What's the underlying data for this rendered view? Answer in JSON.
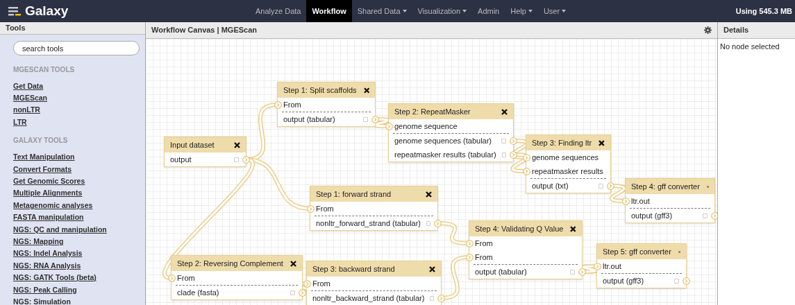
{
  "brand": "Galaxy",
  "nav": [
    {
      "label": "Analyze Data",
      "selected": false,
      "dropdown": false
    },
    {
      "label": "Workflow",
      "selected": true,
      "dropdown": false
    },
    {
      "label": "Shared Data",
      "selected": false,
      "dropdown": true
    },
    {
      "label": "Visualization",
      "selected": false,
      "dropdown": true
    },
    {
      "label": "Admin",
      "selected": false,
      "dropdown": false
    },
    {
      "label": "Help",
      "selected": false,
      "dropdown": true
    },
    {
      "label": "User",
      "selected": false,
      "dropdown": true
    }
  ],
  "usage": "Using 545.3 MB",
  "tools_panel": {
    "title": "Tools",
    "search": {
      "placeholder": "search tools"
    },
    "sections": [
      {
        "heading": "MGESCAN TOOLS",
        "items": [
          "Get Data",
          "MGEScan",
          "nonLTR",
          "LTR"
        ]
      },
      {
        "heading": "GALAXY TOOLS",
        "items": [
          "Text Manipulation",
          "Convert Formats",
          "Get Genomic Scores",
          "Multiple Alignments",
          "Metagenomic analyses",
          "FASTA manipulation",
          "NGS: QC and manipulation",
          "NGS: Mapping",
          "NGS: Indel Analysis",
          "NGS: RNA Analysis",
          "NGS: GATK Tools (beta)",
          "NGS: Peak Calling",
          "NGS: Simulation"
        ]
      }
    ]
  },
  "canvas": {
    "title": "Workflow Canvas | MGEScan",
    "nodes": [
      {
        "title": "Step 1: Split scaffolds",
        "inputs": [
          "From"
        ],
        "outputs": [
          {
            "label": "output (tabular)",
            "checked": false
          }
        ]
      },
      {
        "title": "Step 2: RepeatMasker",
        "inputs": [
          "genome sequence"
        ],
        "outputs": [
          {
            "label": "genome sequences (tabular)",
            "checked": false
          },
          {
            "label": "repeatmasker results (tabular)",
            "checked": false
          }
        ]
      },
      {
        "title": "Input dataset",
        "outputs": [
          {
            "label": "output",
            "checked": false
          }
        ]
      },
      {
        "title": "Step 3: Finding ltr",
        "inputs": [
          "genome sequences",
          "repeatmasker results"
        ],
        "outputs": [
          {
            "label": "output (txt)",
            "checked": false
          }
        ]
      },
      {
        "title": "Step 4: gff converter",
        "inputs": [
          "ltr.out"
        ],
        "outputs": [
          {
            "label": "output (gff3)",
            "checked": false
          }
        ]
      },
      {
        "title": "Step 1: forward strand",
        "inputs": [
          "From"
        ],
        "outputs": [
          {
            "label": "nonltr_forward_strand (tabular)",
            "checked": false
          }
        ]
      },
      {
        "title": "Step 4: Validating Q Value",
        "inputs": [
          "From",
          "From"
        ],
        "outputs": [
          {
            "label": "output (tabular)",
            "checked": false
          }
        ]
      },
      {
        "title": "Step 5: gff converter",
        "inputs": [
          "ltr.out"
        ],
        "outputs": [
          {
            "label": "output (gff3)",
            "checked": false
          }
        ]
      },
      {
        "title": "Step 2: Reversing Complement",
        "inputs": [
          "From"
        ],
        "outputs": [
          {
            "label": "clade (fasta)",
            "checked": false
          }
        ]
      },
      {
        "title": "Step 3: backward strand",
        "inputs": [
          "From"
        ],
        "outputs": [
          {
            "label": "nonltr_backward_strand (tabular)",
            "checked": false
          }
        ]
      }
    ]
  },
  "details": {
    "title": "Details",
    "message": "No node selected"
  }
}
